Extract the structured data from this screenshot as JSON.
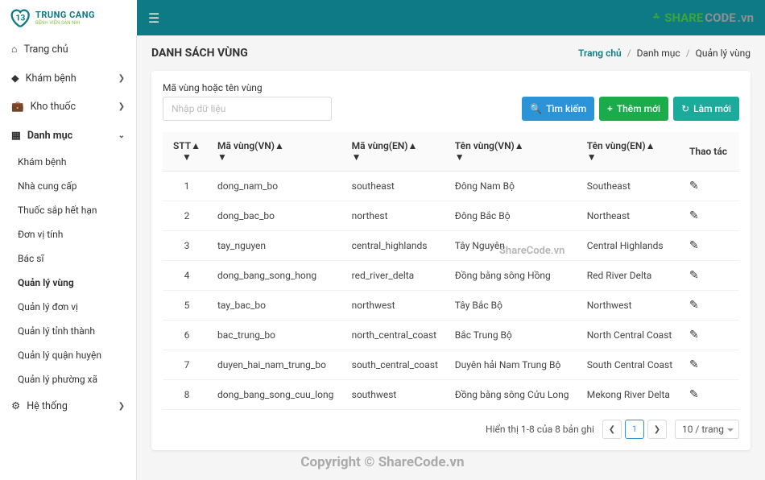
{
  "logo": {
    "brand": "TRUNG CANG",
    "sub": "BỆNH VIỆN SẢN NHI"
  },
  "sharecode": {
    "s": "SHARE",
    "code": "CODE",
    "vn": ".vn"
  },
  "sidebar": {
    "items": [
      {
        "icon": "home",
        "label": "Trang chủ"
      },
      {
        "icon": "diamond",
        "label": "Khám bệnh",
        "chev": "right"
      },
      {
        "icon": "bag",
        "label": "Kho thuốc",
        "chev": "right"
      },
      {
        "icon": "grid",
        "label": "Danh mục",
        "chev": "down",
        "active": true
      }
    ],
    "subs": [
      "Khám bệnh",
      "Nhà cung cấp",
      "Thuốc sắp hết hạn",
      "Đơn vị tính",
      "Bác sĩ",
      "Quản lý vùng",
      "Quản lý đơn vị",
      "Quản lý tỉnh thành",
      "Quản lý quận huyện",
      "Quản lý phường xã"
    ],
    "sub_active_idx": 5,
    "last": {
      "icon": "gear",
      "label": "Hệ thống",
      "chev": "right"
    }
  },
  "page": {
    "title": "DANH SÁCH VÙNG",
    "breadcrumb": {
      "home": "Trang chủ",
      "cat": "Danh mục",
      "curr": "Quản lý vùng"
    }
  },
  "filter": {
    "label": "Mã vùng hoặc tên vùng",
    "placeholder": "Nhập dữ liệu"
  },
  "buttons": {
    "search": "Tìm kiếm",
    "add": "Thêm mới",
    "refresh": "Làm mới"
  },
  "table": {
    "cols": {
      "stt": "STT",
      "codeVn": "Mã vùng(VN)",
      "codeEn": "Mã vùng(EN)",
      "nameVn": "Tên vùng(VN)",
      "nameEn": "Tên vùng(EN)",
      "act": "Thao tác"
    },
    "rows": [
      {
        "stt": "1",
        "codeVn": "dong_nam_bo",
        "codeEn": "southeast",
        "nameVn": "Đông Nam Bộ",
        "nameEn": "Southeast"
      },
      {
        "stt": "2",
        "codeVn": "dong_bac_bo",
        "codeEn": "northest",
        "nameVn": "Đông Bắc Bộ",
        "nameEn": "Northeast"
      },
      {
        "stt": "3",
        "codeVn": "tay_nguyen",
        "codeEn": "central_highlands",
        "nameVn": "Tây Nguyên",
        "nameEn": "Central Highlands"
      },
      {
        "stt": "4",
        "codeVn": "dong_bang_song_hong",
        "codeEn": "red_river_delta",
        "nameVn": "Đồng bằng sông Hồng",
        "nameEn": "Red River Delta"
      },
      {
        "stt": "5",
        "codeVn": "tay_bac_bo",
        "codeEn": "northwest",
        "nameVn": "Tây Bắc Bộ",
        "nameEn": "Northwest"
      },
      {
        "stt": "6",
        "codeVn": "bac_trung_bo",
        "codeEn": "north_central_coast",
        "nameVn": "Bắc Trung Bộ",
        "nameEn": "North Central Coast"
      },
      {
        "stt": "7",
        "codeVn": "duyen_hai_nam_trung_bo",
        "codeEn": "south_central_coast",
        "nameVn": "Duyên hải Nam Trung Bộ",
        "nameEn": "South Central Coast"
      },
      {
        "stt": "8",
        "codeVn": "dong_bang_song_cuu_long",
        "codeEn": "southwest",
        "nameVn": "Đồng bằng sông Cửu Long",
        "nameEn": "Mekong River Delta"
      }
    ]
  },
  "pager": {
    "info": "Hiển thị 1-8 của 8 bản ghi",
    "current": "1",
    "perpage": "10 / trang"
  },
  "watermarks": {
    "center": "Copyright © ShareCode.vn",
    "mid": "ShareCode.vn"
  }
}
